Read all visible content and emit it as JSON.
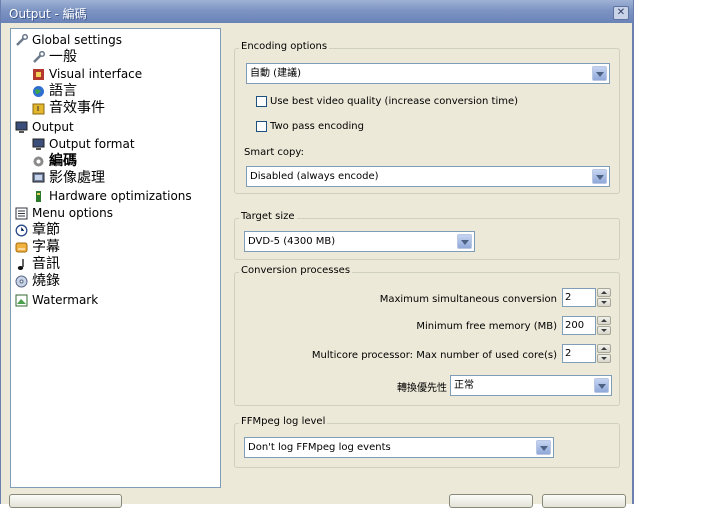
{
  "window": {
    "title": "Output - 編碼"
  },
  "tree": {
    "items": [
      {
        "label": "Global settings",
        "icon": "wrench-icon"
      },
      {
        "label": "一般",
        "icon": "wrench-icon"
      },
      {
        "label": "Visual interface",
        "icon": "palette-icon"
      },
      {
        "label": "語言",
        "icon": "globe-icon"
      },
      {
        "label": "音效事件",
        "icon": "sound-icon"
      },
      {
        "label": "Output",
        "icon": "monitor-icon"
      },
      {
        "label": "Output format",
        "icon": "monitor-icon"
      },
      {
        "label": "編碼",
        "icon": "gear-icon"
      },
      {
        "label": "影像處理",
        "icon": "image-icon"
      },
      {
        "label": "Hardware optimizations",
        "icon": "chip-icon"
      },
      {
        "label": "Menu options",
        "icon": "menu-icon"
      },
      {
        "label": "章節",
        "icon": "clock-icon"
      },
      {
        "label": "字幕",
        "icon": "subtitle-icon"
      },
      {
        "label": "音訊",
        "icon": "music-note-icon"
      },
      {
        "label": "燒錄",
        "icon": "disc-icon"
      },
      {
        "label": "Watermark",
        "icon": "watermark-icon"
      }
    ]
  },
  "encoding_options": {
    "title": "Encoding options",
    "mode_value": "自動 (建議)",
    "best_quality_label": "Use best video quality (increase conversion time)",
    "best_quality_checked": false,
    "two_pass_label": "Two pass encoding",
    "two_pass_checked": false,
    "smart_copy_label": "Smart copy:",
    "smart_copy_value": "Disabled (always encode)"
  },
  "target_size": {
    "title": "Target size",
    "value": "DVD-5 (4300 MB)"
  },
  "conversion": {
    "title": "Conversion processes",
    "max_simul_label": "Maximum simultaneous conversion",
    "max_simul_value": "2",
    "min_mem_label": "Minimum free memory (MB)",
    "min_mem_value": "200",
    "multicore_label": "Multicore processor: Max number of used core(s)",
    "multicore_value": "2",
    "priority_label": "轉換優先性",
    "priority_value": "正常"
  },
  "ffmpeg": {
    "title": "FFMpeg log level",
    "value": "Don't log FFMpeg log events"
  },
  "colors": {
    "titlebar": "#7d94c3",
    "dialog_bg": "#ece9d8",
    "field_border": "#7f9db9"
  }
}
